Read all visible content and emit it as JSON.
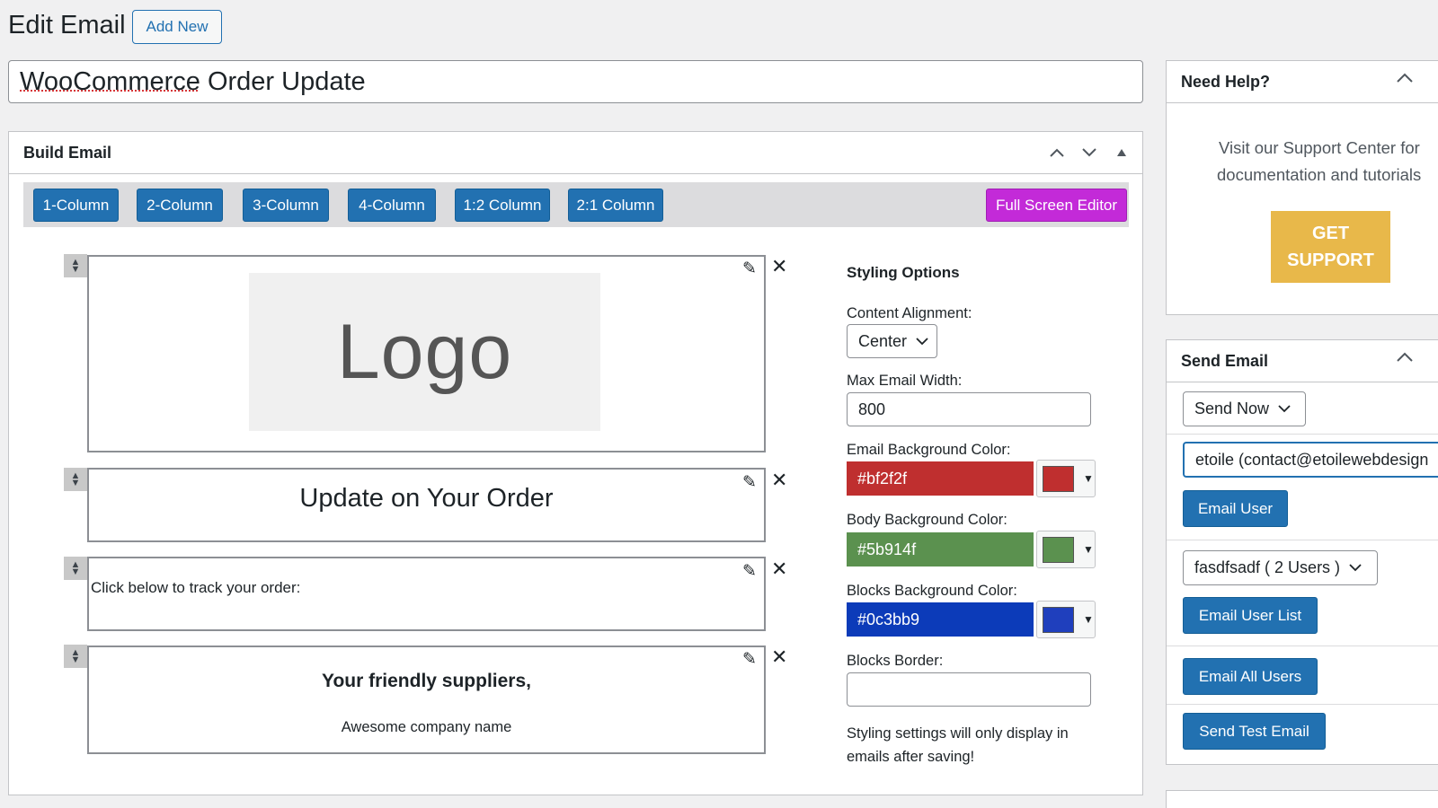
{
  "header": {
    "title": "Edit Email",
    "add_new": "Add New"
  },
  "post_title": {
    "prefix": "WooCommerce",
    "rest": " Order Update"
  },
  "build": {
    "title": "Build Email",
    "column_buttons": [
      "1-Column",
      "2-Column",
      "3-Column",
      "4-Column",
      "1:2 Column",
      "2:1 Column"
    ],
    "full_screen": "Full Screen Editor"
  },
  "blocks": {
    "logo": "Logo",
    "heading": "Update on Your Order",
    "tracking": "Click below to track your order:",
    "signoff": "Your friendly suppliers,",
    "company": "Awesome company name"
  },
  "styling": {
    "title": "Styling Options",
    "alignment_label": "Content Alignment:",
    "alignment_value": "Center",
    "width_label": "Max Email Width:",
    "width_value": "800",
    "email_bg_label": "Email Background Color:",
    "email_bg_value": "#bf2f2f",
    "body_bg_label": "Body Background Color:",
    "body_bg_value": "#5b914f",
    "blocks_bg_label": "Blocks Background Color:",
    "blocks_bg_value": "#0c3bb9",
    "border_label": "Blocks Border:",
    "border_value": "",
    "note": "Styling settings will only display in emails after saving!"
  },
  "help": {
    "title": "Need Help?",
    "text_line1": "Visit our Support Center for",
    "text_line2": "documentation and tutorials",
    "button_line1": "GET",
    "button_line2": "SUPPORT"
  },
  "send": {
    "title": "Send Email",
    "timing": "Send Now",
    "user_value": "etoile (contact@etoilewebdesign",
    "email_user": "Email User",
    "list_value": "fasdfsadf ( 2 Users )",
    "email_user_list": "Email User List",
    "email_all": "Email All Users",
    "send_test": "Send Test Email"
  },
  "colors": {
    "accent": "#2271b1",
    "full_screen": "#c32ad8",
    "support": "#e8b84a",
    "email_bg": "#bf2f2f",
    "body_bg": "#5b914f",
    "blocks_bg": "#0c3bb9"
  }
}
